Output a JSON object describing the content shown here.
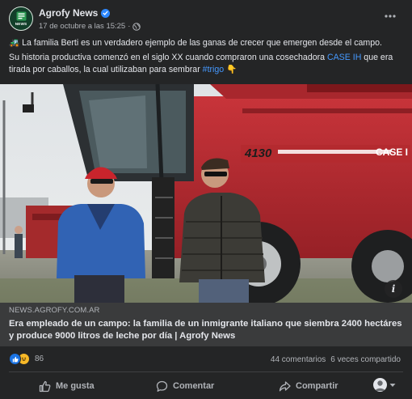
{
  "post": {
    "page_name": "Agrofy News",
    "timestamp": "17 de octubre a las 15:25",
    "avatar_label": "NEWS",
    "text": {
      "p1_emoji": "🚜",
      "p1": "La familia Berti es un verdadero ejemplo de las ganas de crecer que emergen desde el campo.",
      "p2_before": "Su historia productiva comenzó en el siglo XX cuando compraron una cosechadora ",
      "p2_link1": "CASE IH",
      "p2_middle": " que era tirada por caballos, la cual utilizaban para sembrar ",
      "p2_link2": "#trigo",
      "p2_emoji": "👇"
    },
    "photo": {
      "machine_model": "4130",
      "machine_brand": "CASE I"
    },
    "link_preview": {
      "domain": "NEWS.AGROFY.COM.AR",
      "title": "Era empleado de un campo: la familia de un inmigrante italiano que siembra 2400 hectáres y produce 9000 litros de leche por día | Agrofy News"
    },
    "stats": {
      "reaction_count": "86",
      "comments": "44 comentarios",
      "shares": "6 veces compartido"
    },
    "actions": {
      "like": "Me gusta",
      "comment": "Comentar",
      "share": "Compartir"
    },
    "colors": {
      "background": "#242526",
      "link": "#4599ff",
      "like_blue": "#1b74e4",
      "combine_red": "#b3262b"
    }
  }
}
